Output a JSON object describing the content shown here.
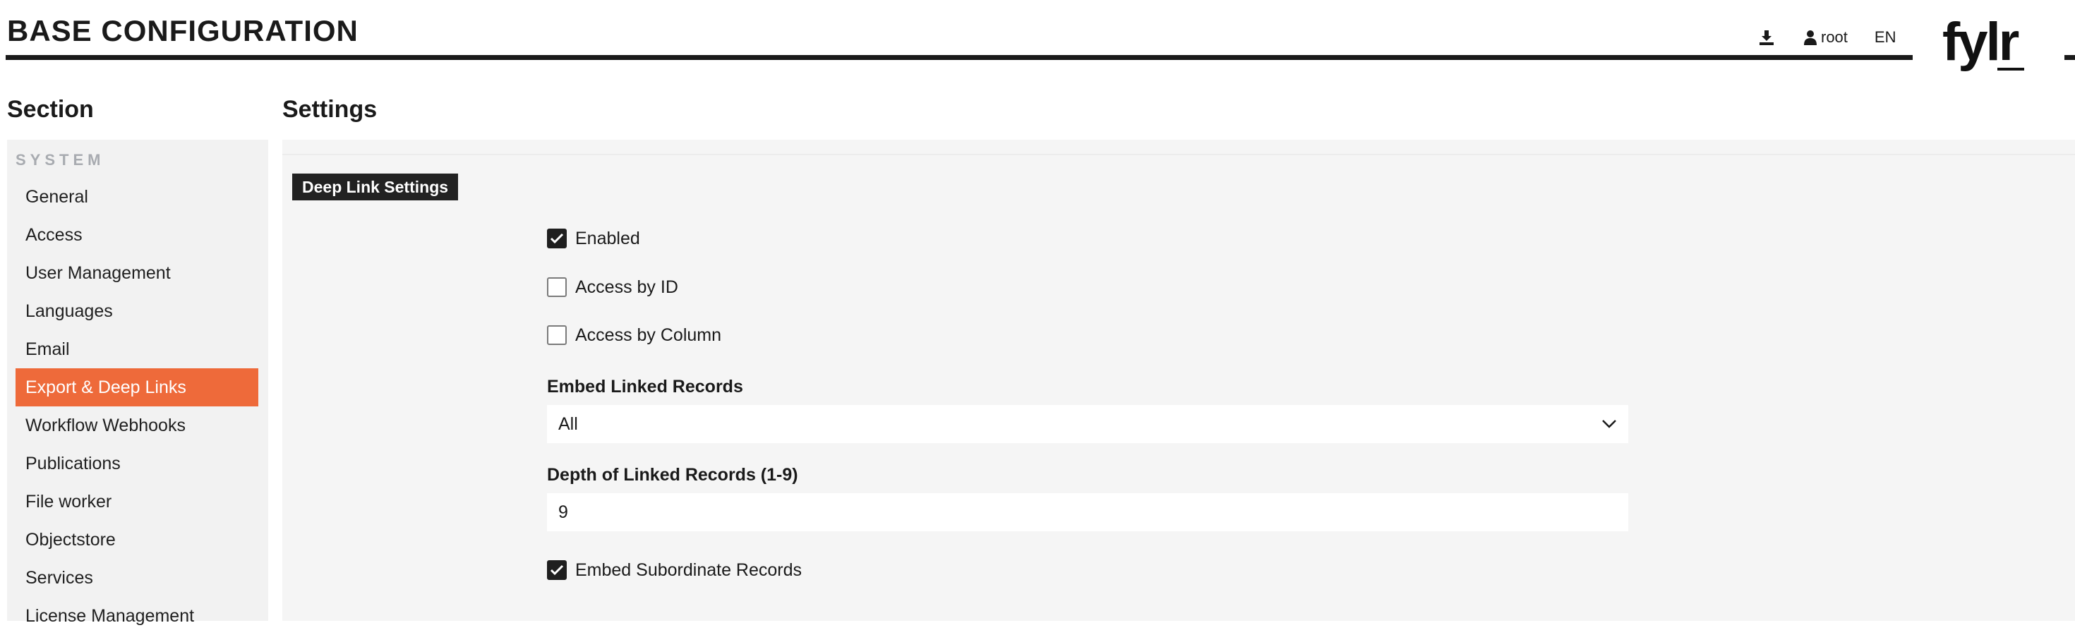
{
  "header": {
    "title": "BASE CONFIGURATION",
    "user": "root",
    "language": "EN",
    "logo_text": "fylr"
  },
  "sidebar": {
    "heading": "Section",
    "group": "SYSTEM",
    "items": [
      {
        "label": "General"
      },
      {
        "label": "Access"
      },
      {
        "label": "User Management"
      },
      {
        "label": "Languages"
      },
      {
        "label": "Email"
      },
      {
        "label": "Export & Deep Links",
        "active": true
      },
      {
        "label": "Workflow Webhooks"
      },
      {
        "label": "Publications"
      },
      {
        "label": "File worker"
      },
      {
        "label": "Objectstore"
      },
      {
        "label": "Services"
      },
      {
        "label": "License Management"
      }
    ]
  },
  "settings": {
    "heading": "Settings",
    "group_label": "Deep Link Settings",
    "enabled_label": "Enabled",
    "access_by_id_label": "Access by ID",
    "access_by_column_label": "Access by Column",
    "embed_linked_label": "Embed Linked Records",
    "embed_linked_value": "All",
    "depth_label": "Depth of Linked Records (1-9)",
    "depth_value": "9",
    "embed_subordinate_label": "Embed Subordinate Records"
  },
  "colors": {
    "accent": "#ee6a3a",
    "dark": "#1a1a1a",
    "sidebar_bg": "#f2f2f2",
    "panel_bg": "#f5f5f5",
    "group_muted": "#a8abb0"
  },
  "icons": [
    "download-icon",
    "user-icon",
    "checkmark-icon",
    "chevron-down-icon"
  ]
}
